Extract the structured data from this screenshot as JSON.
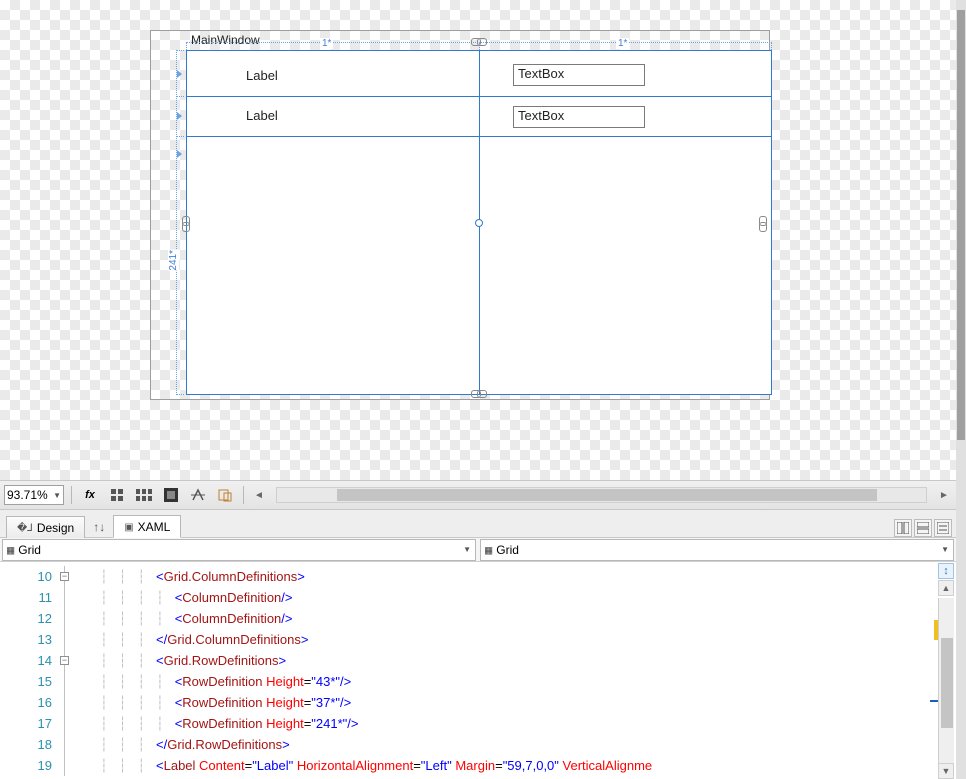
{
  "designer": {
    "window_title": "MainWindow",
    "col_size_labels": [
      "1*",
      "1*"
    ],
    "row_size_label_left": "241*",
    "row1_label": "Label",
    "row1_textbox": "TextBox",
    "row2_label": "Label",
    "row2_textbox": "TextBox"
  },
  "toolbar": {
    "zoom": "93.71%"
  },
  "tabs": {
    "design": "Design",
    "xaml": "XAML"
  },
  "path": {
    "left": "Grid",
    "right": "Grid"
  },
  "code": {
    "lines": [
      {
        "n": 10,
        "fold": "box",
        "indent": 3,
        "tokens": [
          [
            "brk",
            "<"
          ],
          [
            "elem",
            "Grid.ColumnDefinitions"
          ],
          [
            "brk",
            ">"
          ]
        ]
      },
      {
        "n": 11,
        "fold": "line",
        "indent": 4,
        "tokens": [
          [
            "brk",
            "<"
          ],
          [
            "elem",
            "ColumnDefinition"
          ],
          [
            "brk",
            "/>"
          ]
        ]
      },
      {
        "n": 12,
        "fold": "line",
        "indent": 4,
        "tokens": [
          [
            "brk",
            "<"
          ],
          [
            "elem",
            "ColumnDefinition"
          ],
          [
            "brk",
            "/>"
          ]
        ]
      },
      {
        "n": 13,
        "fold": "line",
        "indent": 3,
        "tokens": [
          [
            "brk",
            "</"
          ],
          [
            "elem",
            "Grid.ColumnDefinitions"
          ],
          [
            "brk",
            ">"
          ]
        ]
      },
      {
        "n": 14,
        "fold": "box",
        "indent": 3,
        "tokens": [
          [
            "brk",
            "<"
          ],
          [
            "elem",
            "Grid.RowDefinitions"
          ],
          [
            "brk",
            ">"
          ]
        ]
      },
      {
        "n": 15,
        "fold": "line",
        "indent": 4,
        "tokens": [
          [
            "brk",
            "<"
          ],
          [
            "elem",
            "RowDefinition"
          ],
          [
            "eq",
            " "
          ],
          [
            "attr",
            "Height"
          ],
          [
            "eq",
            "="
          ],
          [
            "val",
            "\"43*\""
          ],
          [
            "brk",
            "/>"
          ]
        ]
      },
      {
        "n": 16,
        "fold": "line",
        "indent": 4,
        "tokens": [
          [
            "brk",
            "<"
          ],
          [
            "elem",
            "RowDefinition"
          ],
          [
            "eq",
            " "
          ],
          [
            "attr",
            "Height"
          ],
          [
            "eq",
            "="
          ],
          [
            "val",
            "\"37*\""
          ],
          [
            "brk",
            "/>"
          ]
        ]
      },
      {
        "n": 17,
        "fold": "line",
        "indent": 4,
        "tokens": [
          [
            "brk",
            "<"
          ],
          [
            "elem",
            "RowDefinition"
          ],
          [
            "eq",
            " "
          ],
          [
            "attr",
            "Height"
          ],
          [
            "eq",
            "="
          ],
          [
            "val",
            "\"241*\""
          ],
          [
            "brk",
            "/>"
          ]
        ]
      },
      {
        "n": 18,
        "fold": "line",
        "indent": 3,
        "tokens": [
          [
            "brk",
            "</"
          ],
          [
            "elem",
            "Grid.RowDefinitions"
          ],
          [
            "brk",
            ">"
          ]
        ]
      },
      {
        "n": 19,
        "fold": "line",
        "indent": 3,
        "tokens": [
          [
            "brk",
            "<"
          ],
          [
            "elem",
            "Label"
          ],
          [
            "eq",
            " "
          ],
          [
            "attr",
            "Content"
          ],
          [
            "eq",
            "="
          ],
          [
            "val",
            "\"Label\""
          ],
          [
            "eq",
            " "
          ],
          [
            "attr",
            "HorizontalAlignment"
          ],
          [
            "eq",
            "="
          ],
          [
            "val",
            "\"Left\""
          ],
          [
            "eq",
            " "
          ],
          [
            "attr",
            "Margin"
          ],
          [
            "eq",
            "="
          ],
          [
            "val",
            "\"59,7,0,0\""
          ],
          [
            "eq",
            " "
          ],
          [
            "attr",
            "VerticalAlignme"
          ]
        ]
      }
    ]
  }
}
